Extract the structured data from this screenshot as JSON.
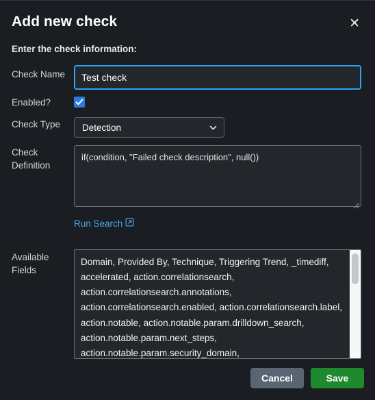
{
  "dialog": {
    "title": "Add new check",
    "close_icon": "close-icon",
    "subtitle": "Enter the check information:"
  },
  "form": {
    "check_name": {
      "label": "Check Name",
      "value": "Test check",
      "placeholder": ""
    },
    "enabled": {
      "label": "Enabled?",
      "checked": true,
      "check_color": "#2a7ae4"
    },
    "check_type": {
      "label": "Check Type",
      "selected": "Detection",
      "options": [
        "Detection"
      ],
      "chevron_icon": "chevron-down-icon"
    },
    "check_definition": {
      "label": "Check Definition",
      "value": "if(condition, \"Failed check description\", null())",
      "placeholder": ""
    },
    "run_search": {
      "label": "Run Search",
      "icon": "external-link-icon",
      "color": "#4aa8e8"
    },
    "available_fields": {
      "label": "Available Fields",
      "value": "Domain, Provided By, Technique, Triggering Trend, _timediff, accelerated, action.correlationsearch, action.correlationsearch.annotations, action.correlationsearch.enabled, action.correlationsearch.label, action.notable, action.notable.param.drilldown_search, action.notable.param.next_steps, action.notable.param.security_domain,"
    }
  },
  "footer": {
    "cancel_label": "Cancel",
    "save_label": "Save",
    "cancel_color": "#5a6472",
    "save_color": "#1e8a2d"
  }
}
